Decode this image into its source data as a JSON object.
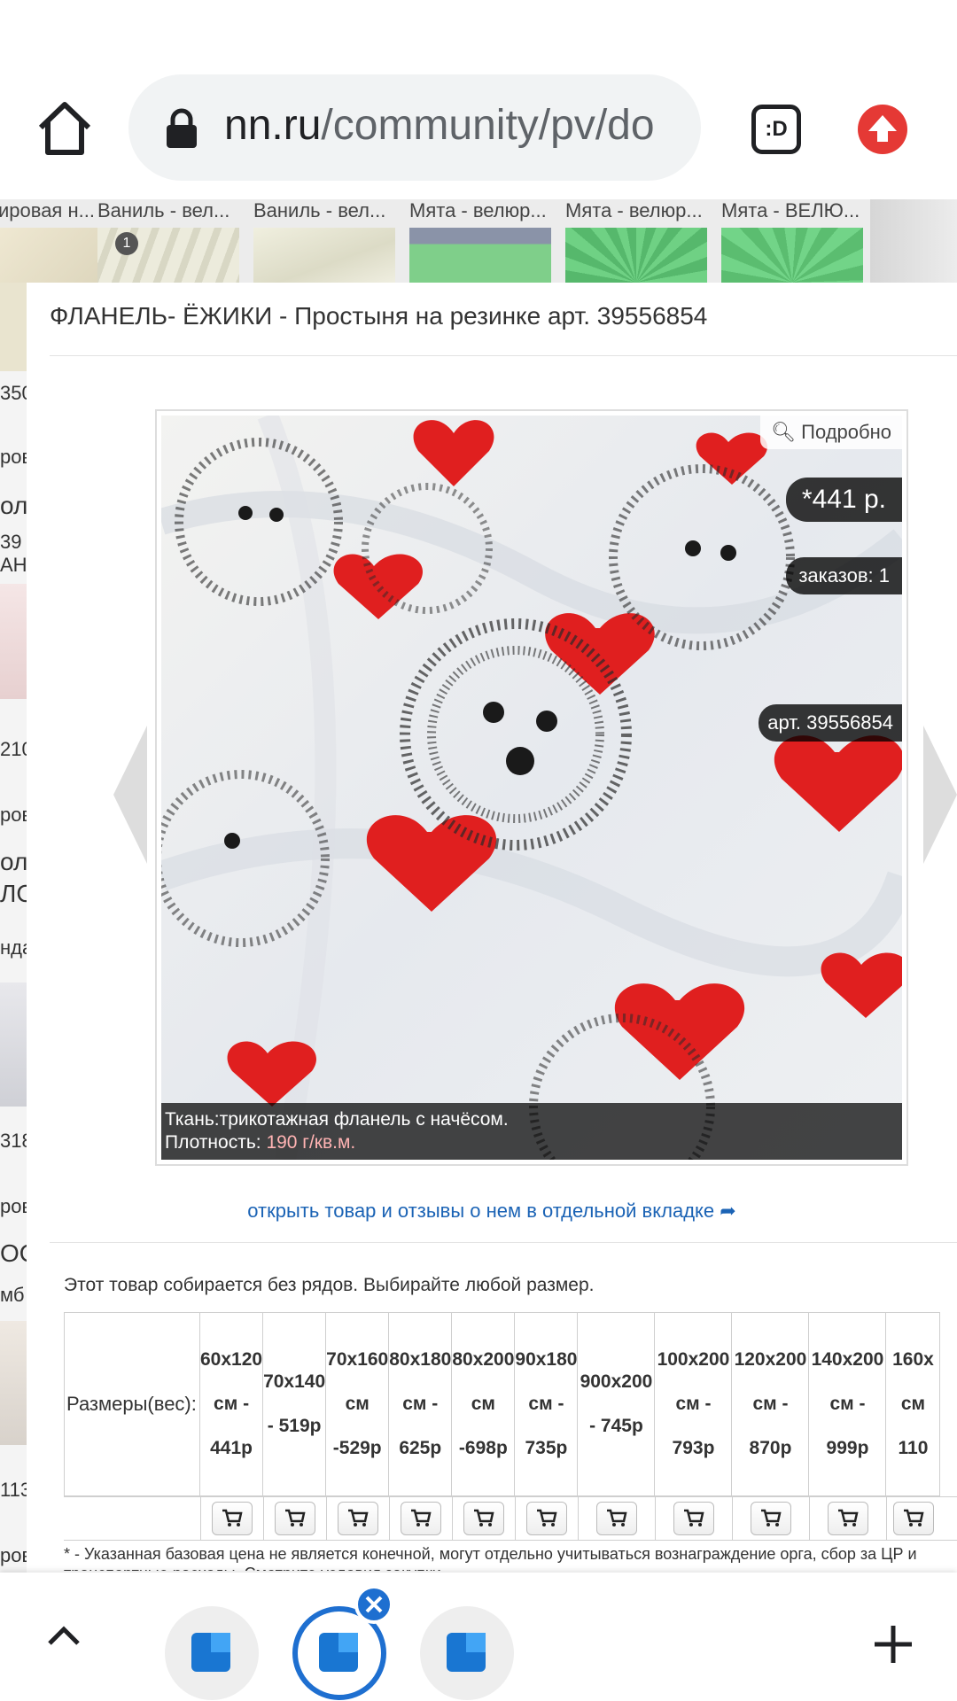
{
  "browser": {
    "url_domain": "nn.ru",
    "url_path": "/community/pv/do",
    "reader_label": ":D"
  },
  "strip": {
    "items": [
      {
        "label": "ировая н..."
      },
      {
        "label": "Ваниль - вел..."
      },
      {
        "label": "Ваниль - вел..."
      },
      {
        "label": "Мята - велюр..."
      },
      {
        "label": "Мята - велюр..."
      },
      {
        "label": "Мята - ВЕЛЮ..."
      }
    ],
    "badge": "1"
  },
  "left_bg": {
    "fragments": [
      "350",
      "ров",
      "олл",
      "39",
      "АНЕ",
      "210",
      "ров",
      "олл",
      "ЛО",
      "нда",
      "318",
      "ров",
      "ОО",
      "мб",
      "113",
      "ров"
    ]
  },
  "modal": {
    "title": "ФЛАНЕЛЬ- ЁЖИКИ - Простыня на резинке арт. 39556854",
    "zoom_label": "Подробно",
    "price": "*441 р.",
    "orders": "заказов: 1",
    "article": "арт. 39556854",
    "caption_line1": "Ткань:трикотажная фланель с начёсом.",
    "caption_line2_prefix": "Плотность: ",
    "caption_line2_value": "190 г/кв.м.",
    "open_link": "открыть товар и отзывы о нем в отдельной вкладке",
    "note": "Этот товар собирается без рядов. Выбирайте любой размер.",
    "sizes_label": "Размеры(вес):",
    "sizes": [
      "60x120\nсм -\n441р",
      "70x140\n- 519р",
      "70x160\nсм\n-529р",
      "80x180\nсм -\n625р",
      "80x200\nсм\n-698р",
      "90x180\nсм -\n735р",
      "900x200\n- 745р",
      "100x200\nсм -\n793р",
      "120x200\nсм -\n870р",
      "140x200\nсм -\n999р",
      "160x\nсм\n110"
    ],
    "footnote": "* - Указанная базовая цена не является конечной, могут отдельно учитываться вознаграждение орга, сбор за ЦР и транспортные расходы. Смотрите условия закупки."
  },
  "colors": {
    "accent": "#1e6fd0",
    "link": "#1b63b5",
    "update": "#e53935"
  }
}
